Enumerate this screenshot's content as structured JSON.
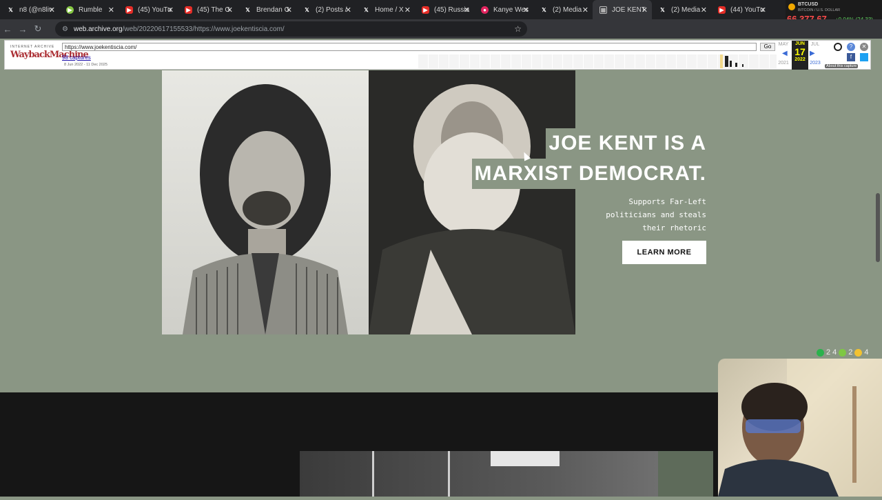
{
  "tabs": [
    {
      "title": "n8 (@n8liv",
      "icon": "x-icon"
    },
    {
      "title": "Rumble",
      "icon": "rumble-icon"
    },
    {
      "title": "(45) YouTu",
      "icon": "youtube-icon"
    },
    {
      "title": "(45) The G",
      "icon": "youtube-icon"
    },
    {
      "title": "Brendan G",
      "icon": "x-icon"
    },
    {
      "title": "(2) Posts /",
      "icon": "x-icon"
    },
    {
      "title": "Home / X",
      "icon": "x-icon"
    },
    {
      "title": "(45) Russia",
      "icon": "youtube-icon"
    },
    {
      "title": "Kanye Wes",
      "icon": "kanye-icon"
    },
    {
      "title": "(2) Media",
      "icon": "x-icon"
    },
    {
      "title": "JOE KENT",
      "icon": "archive-icon",
      "active": true
    },
    {
      "title": "(2) Media",
      "icon": "x-icon"
    },
    {
      "title": "(44) YouTu",
      "icon": "youtube-icon"
    }
  ],
  "ticker": {
    "symbol": "BTCUSD",
    "name": "BITCOIN / U.S. DOLLAR",
    "price": "66,377.67",
    "change": "+0.04% (24.33)"
  },
  "address_bar": {
    "host": "web.archive.org",
    "path": "/web/20220617155533/https://www.joekentiscia.com/"
  },
  "wayback": {
    "logo_top": "INTERNET ARCHIVE",
    "logo": "WaybackMachine",
    "url_value": "https://www.joekentiscia.com/",
    "go_label": "Go",
    "captures": "98 captures",
    "range": "8 Jun 2022 - 11 Dec 2025",
    "prev_month": "MAY",
    "month": "JUN",
    "next_month": "JUL",
    "day": "17",
    "prev_year": "2021",
    "year": "2022",
    "next_year": "2023",
    "about": "About this capture"
  },
  "hero": {
    "title_line1": "JOE KENT IS A",
    "title_line2": "MARXIST DEMOCRAT.",
    "subtitle_line1": "Supports Far-Left",
    "subtitle_line2": "politicians and steals",
    "subtitle_line3": "their rhetoric",
    "cta_label": "LEARN MORE"
  },
  "counters": {
    "first": "2",
    "second": "4",
    "third": "2",
    "fourth": "4"
  },
  "colors": {
    "page_bg": "#8a9684",
    "dark_section": "#161616",
    "price": "#ff4b4b"
  }
}
